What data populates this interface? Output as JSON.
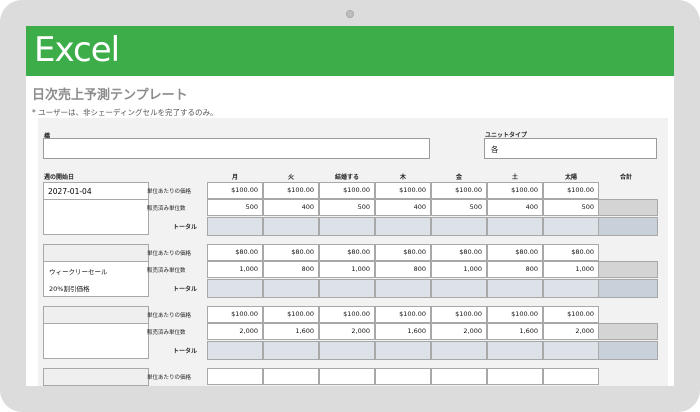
{
  "brand": {
    "name": "Excel"
  },
  "title": "日次売上予測テンプレート",
  "note": "* ユーザーは、非シェーディングセルを完了するのみ。",
  "form": {
    "item_label": "橋",
    "item_value": "",
    "unit_type_label": "ユニットタイプ",
    "unit_type_value": "各"
  },
  "week": {
    "start_label": "週の開始日",
    "start_value": "2027-01-04",
    "days": [
      "月",
      "火",
      "結婚する",
      "木",
      "金",
      "土",
      "太陽"
    ],
    "total_col": "合計"
  },
  "row_labels": {
    "price": "単位あたりの価格",
    "units": "販売済み単位数",
    "total": "トータル"
  },
  "blocks": [
    {
      "header": "2027-01-04",
      "notes": [],
      "price": [
        "$100.00",
        "$100.00",
        "$100.00",
        "$100.00",
        "$100.00",
        "$100.00",
        "$100.00"
      ],
      "units": [
        "500",
        "400",
        "500",
        "400",
        "500",
        "400",
        "500"
      ]
    },
    {
      "header": "",
      "notes": [
        "ウィークリーセール",
        "20%割引価格"
      ],
      "price": [
        "$80.00",
        "$80.00",
        "$80.00",
        "$80.00",
        "$80.00",
        "$80.00",
        "$80.00"
      ],
      "units": [
        "1,000",
        "800",
        "1,000",
        "800",
        "1,000",
        "800",
        "1,000"
      ]
    },
    {
      "header": "",
      "notes": [],
      "price": [
        "$100.00",
        "$100.00",
        "$100.00",
        "$100.00",
        "$100.00",
        "$100.00",
        "$100.00"
      ],
      "units": [
        "2,000",
        "1,600",
        "2,000",
        "1,600",
        "2,000",
        "1,600",
        "2,000"
      ]
    },
    {
      "header": "",
      "notes": [],
      "price": [
        "",
        "",
        "",
        "",
        "",
        "",
        ""
      ],
      "units": []
    }
  ]
}
